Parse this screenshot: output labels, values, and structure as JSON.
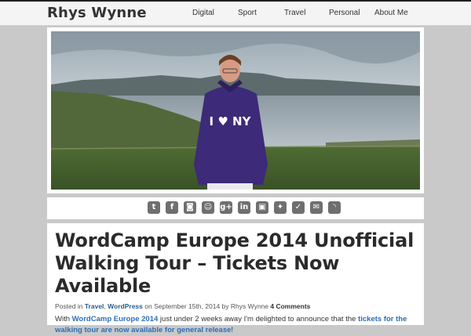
{
  "site": {
    "title": "Rhys Wynne"
  },
  "nav": {
    "items": [
      "Digital",
      "Sport",
      "Travel",
      "Personal",
      "About Me"
    ]
  },
  "hero": {
    "shirt_text": "I ♥ NY"
  },
  "social": {
    "icons": [
      {
        "name": "twitter-icon",
        "glyph": "t"
      },
      {
        "name": "facebook-icon",
        "glyph": "f"
      },
      {
        "name": "instagram-icon",
        "glyph": "◙"
      },
      {
        "name": "github-icon",
        "glyph": "☺"
      },
      {
        "name": "google-plus-icon",
        "glyph": "g+"
      },
      {
        "name": "linkedin-icon",
        "glyph": "in"
      },
      {
        "name": "windows-live-icon",
        "glyph": "▣"
      },
      {
        "name": "flickr-icon",
        "glyph": "✦"
      },
      {
        "name": "foursquare-icon",
        "glyph": "✓"
      },
      {
        "name": "email-icon",
        "glyph": "✉"
      },
      {
        "name": "rss-icon",
        "glyph": "◝"
      }
    ]
  },
  "post": {
    "title": "WordCamp Europe 2014 Unofficial Walking Tour – Tickets Now Available",
    "meta": {
      "posted_in": "Posted in",
      "category_1": "Travel",
      "sep": ",",
      "category_2": "WordPress",
      "date_text": "on September 15th, 2014 by Rhys Wynne",
      "comments": "4 Comments"
    },
    "excerpt": {
      "pre": "With",
      "link_1": "WordCamp Europe 2014",
      "mid": "just under 2 weeks away I'm delighted to announce that the",
      "link_2": "tickets for the walking tour are now available for general release",
      "post": "!"
    }
  }
}
